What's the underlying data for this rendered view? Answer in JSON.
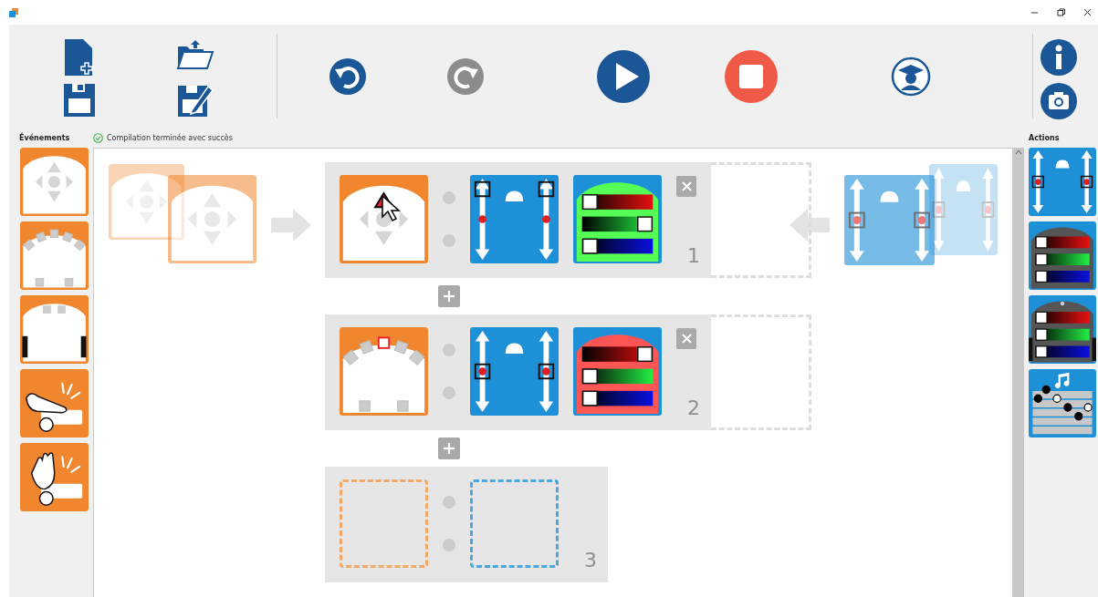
{
  "window": {
    "controls": [
      {
        "kind": "minimize"
      },
      {
        "kind": "restore"
      },
      {
        "kind": "close"
      }
    ]
  },
  "toolbar": {
    "file": [
      {
        "kind": "new"
      },
      {
        "kind": "open"
      },
      {
        "kind": "save"
      },
      {
        "kind": "save-as"
      }
    ],
    "main": [
      {
        "kind": "undo",
        "disabled": false
      },
      {
        "kind": "redo",
        "disabled": true
      },
      {
        "kind": "run",
        "disabled": false
      },
      {
        "kind": "stop",
        "disabled": false
      },
      {
        "kind": "teacher",
        "disabled": false
      }
    ],
    "help": [
      {
        "kind": "info"
      },
      {
        "kind": "camera"
      }
    ]
  },
  "events_palette": {
    "title": "Événements",
    "items": [
      {
        "kind": "buttons"
      },
      {
        "kind": "proximity"
      },
      {
        "kind": "ground"
      },
      {
        "kind": "tap"
      },
      {
        "kind": "clap"
      }
    ]
  },
  "status": {
    "text": "Compilation terminée avec succès",
    "ok": true
  },
  "actions_palette": {
    "title": "Actions",
    "items": [
      {
        "kind": "motors",
        "left": {
          "level": 0.5
        },
        "right": {
          "level": 0.5
        }
      },
      {
        "kind": "top-led",
        "red": {
          "level": 0
        },
        "green": {
          "level": 0
        },
        "blue": {
          "level": 0
        }
      },
      {
        "kind": "bottom-led",
        "red": {
          "level": 0
        },
        "green": {
          "level": 0
        },
        "blue": {
          "level": 0
        }
      },
      {
        "kind": "music"
      }
    ]
  },
  "drag_hints": {
    "events": [
      {
        "kind": "buttons"
      },
      {
        "kind": "buttons"
      }
    ],
    "actions": [
      {
        "kind": "motors",
        "left": {
          "level": 0.5
        },
        "right": {
          "level": 0.5
        }
      },
      {
        "kind": "motors",
        "left": {
          "level": 0.5
        },
        "right": {
          "level": 0.5
        }
      }
    ]
  },
  "rows": [
    {
      "kind": "rule",
      "number": "1",
      "event": {
        "kind": "buttons",
        "buttons": [
          {
            "selected": true
          },
          {
            "selected": false
          },
          {
            "selected": false
          },
          {
            "selected": false
          },
          {
            "selected": false
          }
        ]
      },
      "actions": [
        {
          "kind": "motors",
          "left": {
            "level": 1
          },
          "right": {
            "level": 1
          }
        },
        {
          "kind": "top-led",
          "red": {
            "level": 0
          },
          "green": {
            "level": 1
          },
          "blue": {
            "level": 0
          }
        }
      ]
    },
    {
      "kind": "rule",
      "number": "2",
      "event": {
        "kind": "proximity",
        "sensors": [
          {
            "selected": false
          },
          {
            "selected": false
          },
          {
            "selected": true
          },
          {
            "selected": false
          },
          {
            "selected": false
          },
          {
            "selected": false
          },
          {
            "selected": false
          }
        ]
      },
      "actions": [
        {
          "kind": "motors",
          "left": {
            "level": 0.5
          },
          "right": {
            "level": 0.5
          }
        },
        {
          "kind": "top-led",
          "red": {
            "level": 1
          },
          "green": {
            "level": 0
          },
          "blue": {
            "level": 0
          }
        }
      ]
    },
    {
      "kind": "empty",
      "number": "3"
    }
  ]
}
